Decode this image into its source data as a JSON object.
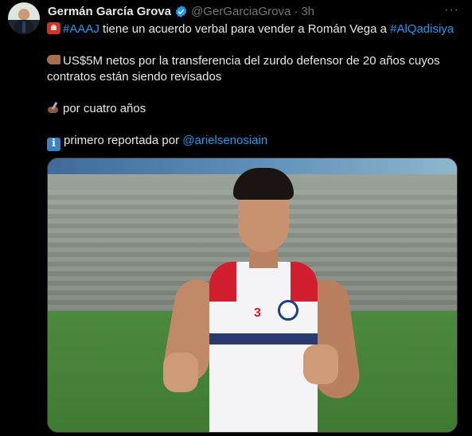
{
  "tweet": {
    "author_name": "Germán García Grova",
    "handle": "@GerGarciaGrova",
    "separator": "·",
    "time": "3h",
    "more_label": "···",
    "line1_hashtag1": "#AAAJ",
    "line1_text": " tiene un acuerdo verbal para vender a Román Vega a ",
    "line1_hashtag2": "#AlQadisiya",
    "line2_text": "US$5M netos por la transferencia del zurdo defensor de 20 años cuyos contratos están siendo revisados",
    "line3_text": "por cuatro años",
    "line4_text": "primero reportada por ",
    "line4_mention": "@arielsenosiain",
    "info_glyph": "i"
  },
  "colors": {
    "link": "#1d9bf0",
    "verified": "#1d9bf0",
    "secondary": "#71767b"
  },
  "icons": [
    "avatar",
    "verified-icon",
    "more-icon",
    "siren-icon",
    "pointing-hand-icon",
    "writing-hand-icon",
    "info-icon"
  ]
}
